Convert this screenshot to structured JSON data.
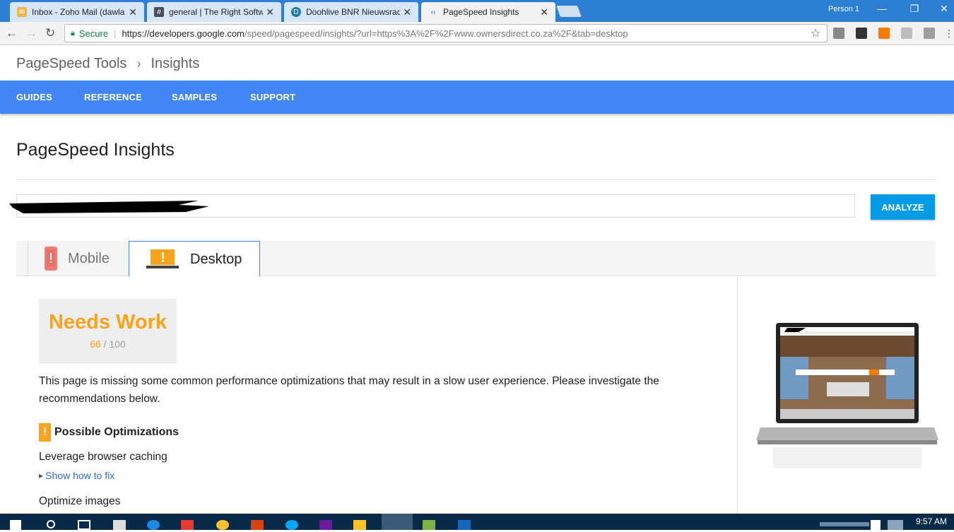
{
  "browser": {
    "tabs": [
      {
        "title": "Inbox - Zoho Mail (dawla"
      },
      {
        "title": "general | The Right Softw"
      },
      {
        "title": "Doohlive BNR Nieuwsrad"
      },
      {
        "title": "PageSpeed Insights"
      }
    ],
    "person": "Person 1",
    "omnibox": {
      "secure_label": "Secure",
      "url_host": "https://developers.google.com",
      "url_rest": "/speed/pagespeed/insights/?url=https%3A%2F%2Fwww.ownersdirect.co.za%2F&tab=desktop"
    }
  },
  "site": {
    "breadcrumb": [
      "PageSpeed Tools",
      "Insights"
    ],
    "nav": [
      "GUIDES",
      "REFERENCE",
      "SAMPLES",
      "SUPPORT"
    ],
    "page_title": "PageSpeed Insights",
    "analyze_label": "ANALYZE",
    "device_tabs": {
      "mobile": "Mobile",
      "desktop": "Desktop"
    }
  },
  "result": {
    "score_label": "Needs Work",
    "score_value": "66",
    "score_max": "/ 100",
    "summary": "This page is missing some common performance optimizations that may result in a slow user experience. Please investigate the recommendations below.",
    "section_title": "Possible Optimizations",
    "rules": [
      "Leverage browser caching",
      "Optimize images"
    ],
    "show_fix": "Show how to fix"
  },
  "taskbar": {
    "clock": "9:57 AM"
  },
  "colors": {
    "accent_blue": "#4285f4",
    "analyze_blue": "#039be5",
    "warning_orange": "#f9a21b",
    "link_blue": "#3367d6"
  }
}
